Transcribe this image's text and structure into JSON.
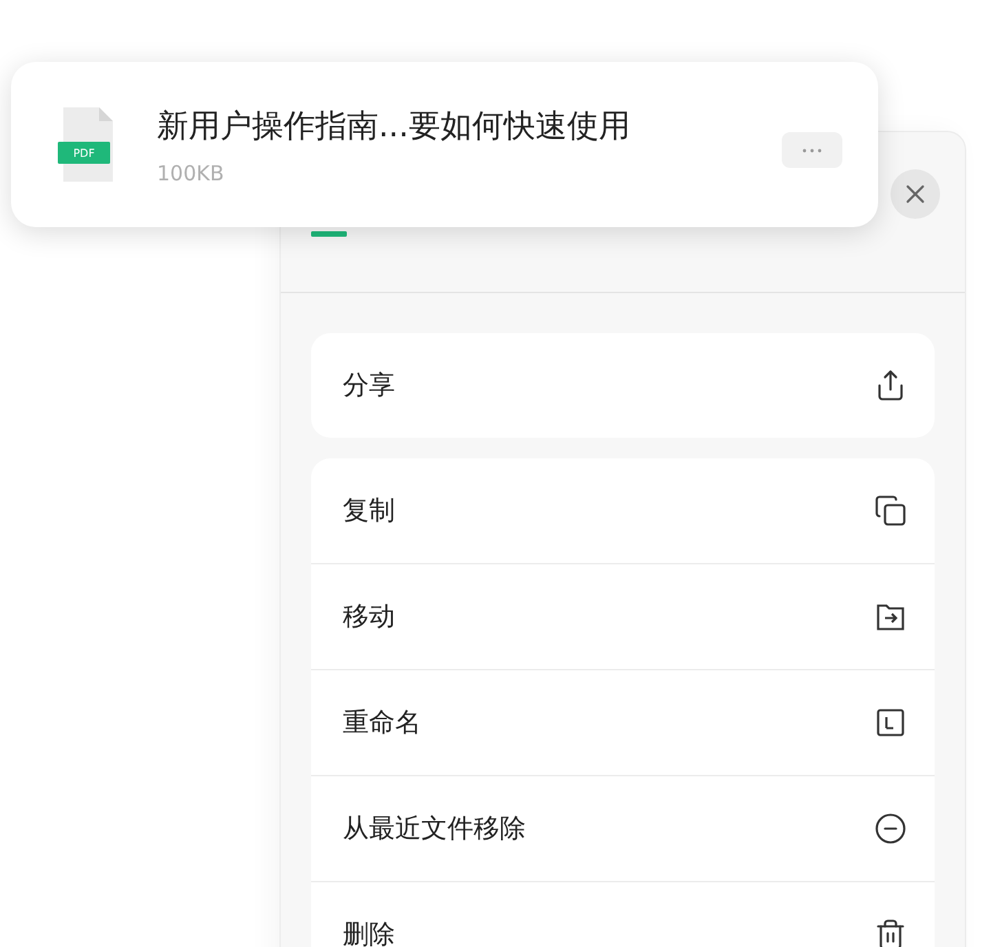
{
  "file": {
    "title": "新用户操作指南...要如何快速使用",
    "size": "100KB",
    "badge": "PDF"
  },
  "action_groups": [
    {
      "items": [
        {
          "label": "分享",
          "kind": "share"
        }
      ]
    },
    {
      "items": [
        {
          "label": "复制",
          "kind": "copy"
        },
        {
          "label": "移动",
          "kind": "move"
        },
        {
          "label": "重命名",
          "kind": "rename"
        },
        {
          "label": "从最近文件移除",
          "kind": "remove"
        },
        {
          "label": "删除",
          "kind": "delete"
        }
      ]
    }
  ]
}
